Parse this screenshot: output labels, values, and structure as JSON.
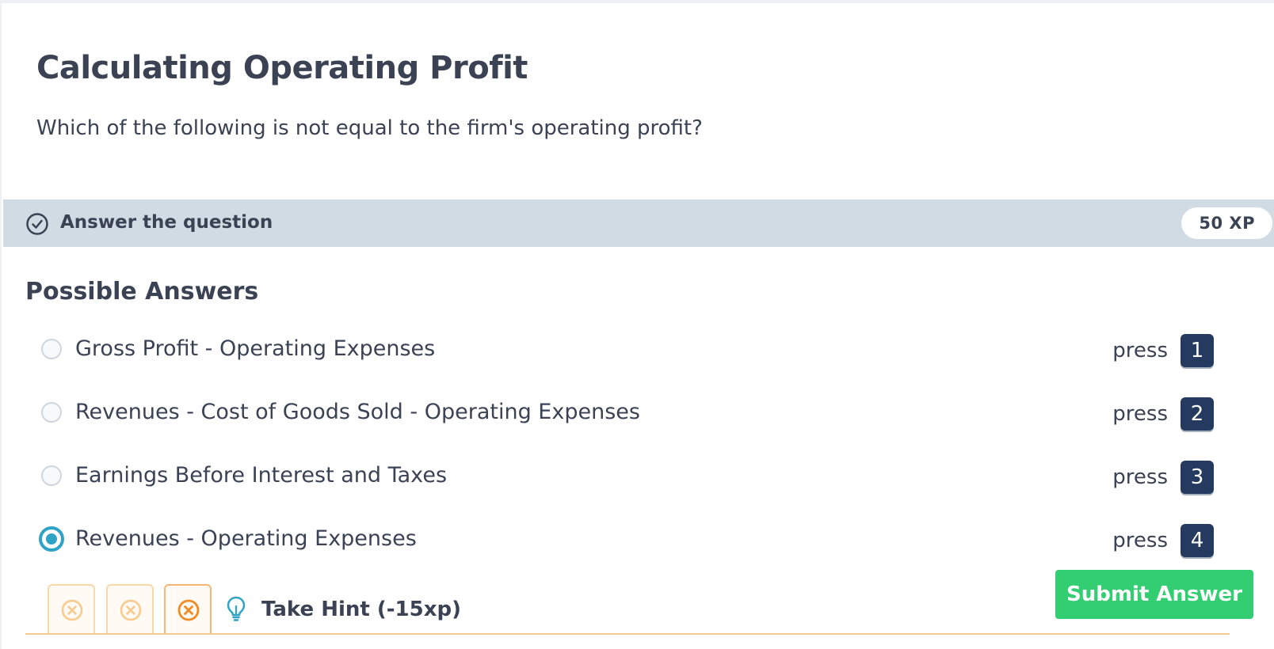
{
  "exercise": {
    "title": "Calculating Operating Profit",
    "question": "Which of the following is not equal to the firm's operating profit?"
  },
  "task": {
    "label": "Answer the question",
    "xp": "50 XP",
    "icon": "check-circle-icon"
  },
  "answers": {
    "heading": "Possible Answers",
    "press_label": "press",
    "selected_index": 3,
    "options": [
      {
        "text": "Gross Profit - Operating Expenses",
        "key": "1"
      },
      {
        "text": "Revenues - Cost of Goods Sold - Operating Expenses",
        "key": "2"
      },
      {
        "text": "Earnings Before Interest and Taxes",
        "key": "3"
      },
      {
        "text": "Revenues - Operating Expenses",
        "key": "4"
      }
    ]
  },
  "footer": {
    "hint_label": "Take Hint (-15xp)",
    "hint_icon": "lightbulb-icon",
    "attempt_icon": "x-circle-icon",
    "submit_label": "Submit Answer"
  },
  "colors": {
    "accent_blue": "#2fa3c6",
    "submit_green": "#34ce72",
    "key_badge": "#243a5e",
    "task_bar": "#d1dbe3",
    "attempt_orange": "#f08a24"
  }
}
